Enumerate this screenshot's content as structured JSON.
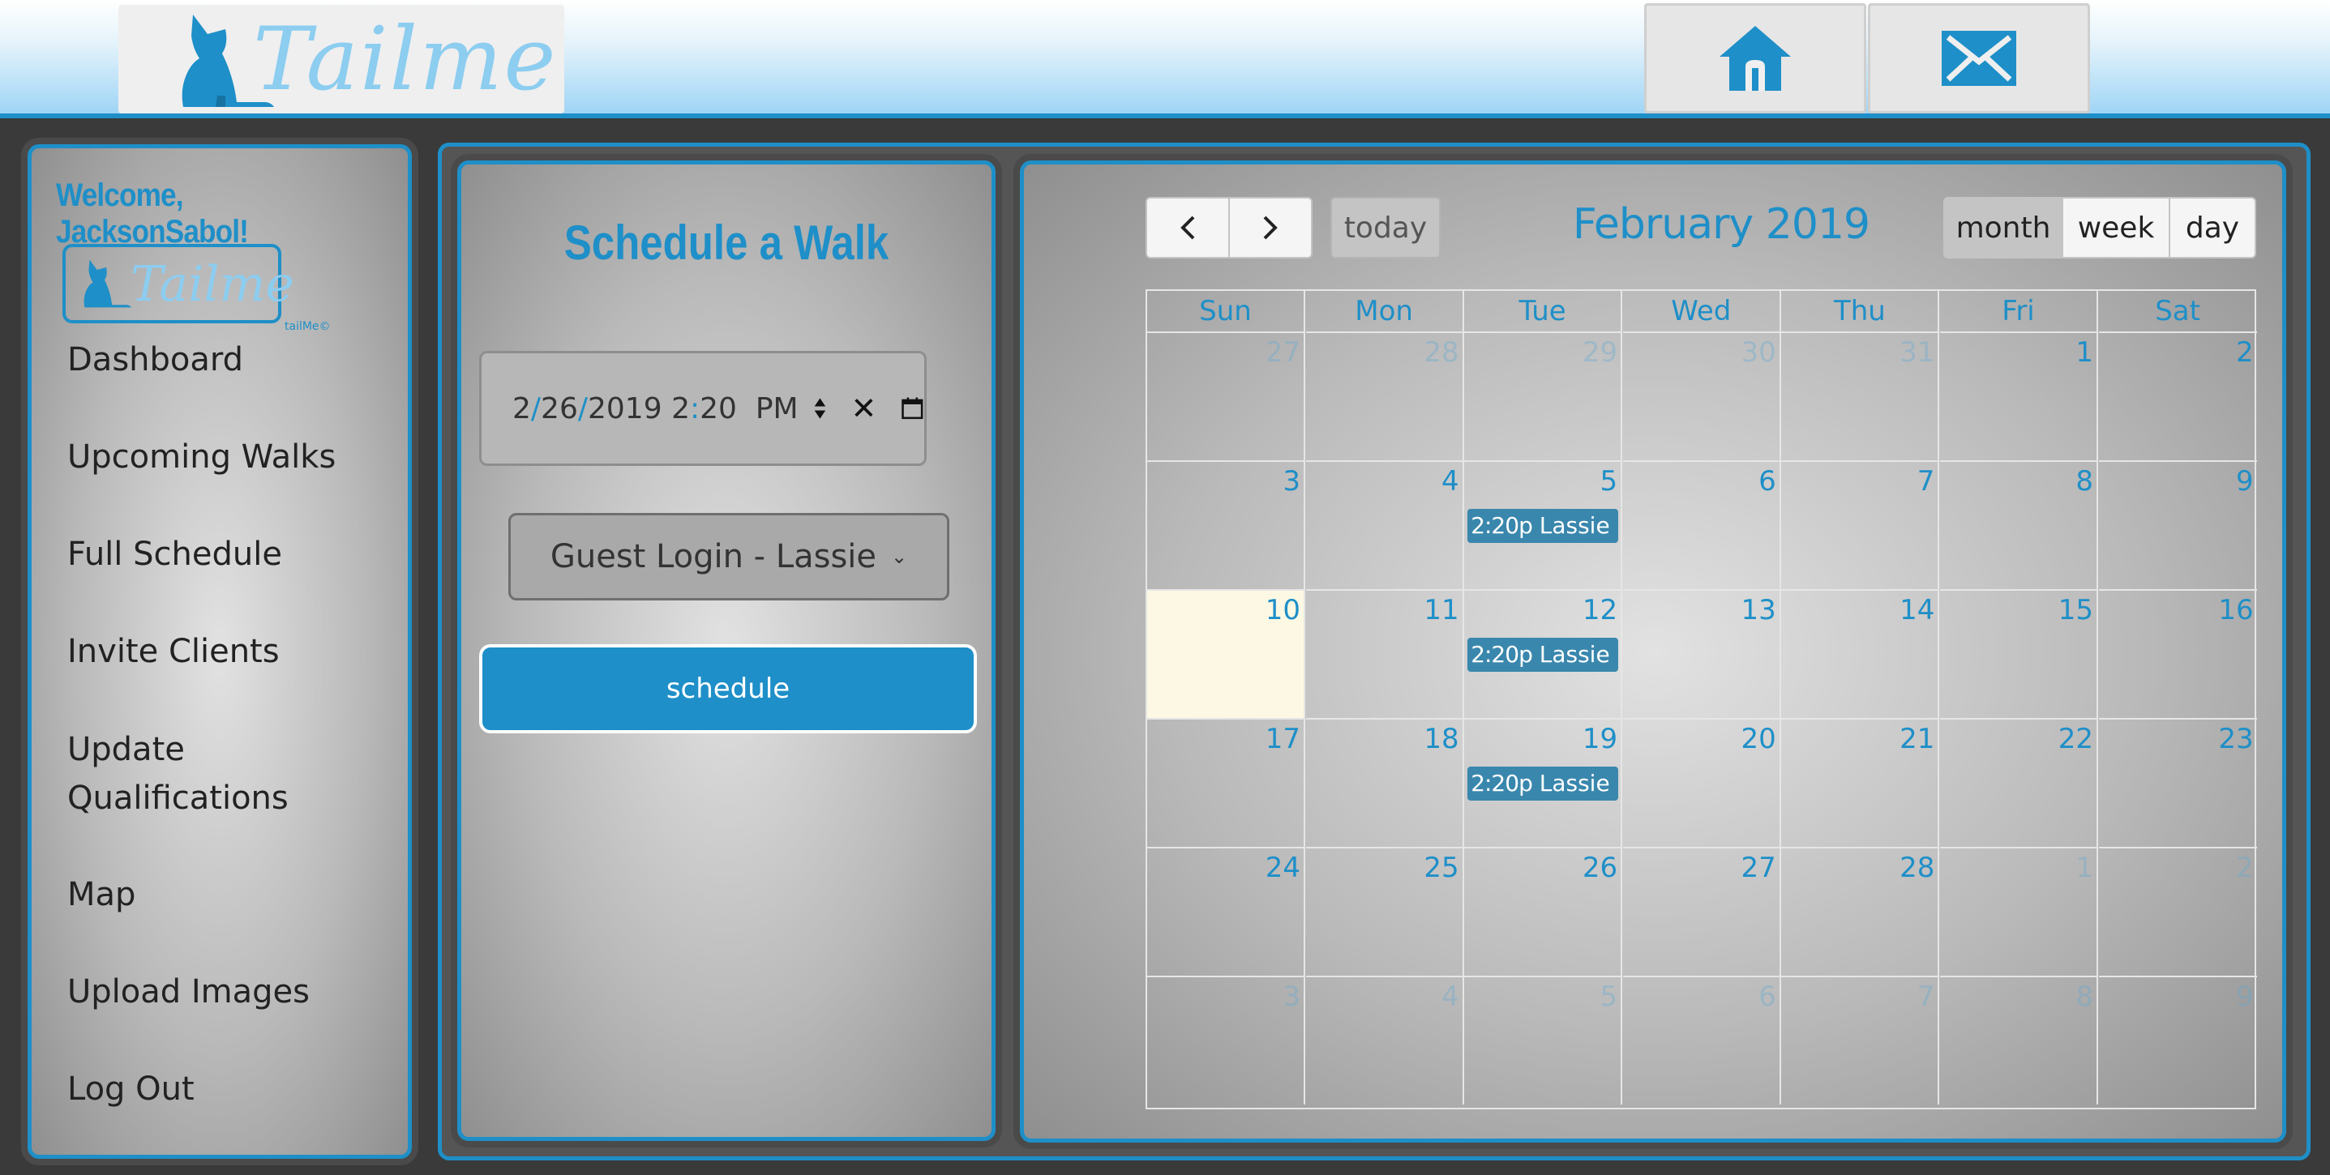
{
  "header": {
    "logo_text": "Tailme",
    "home_button_icon": "home-icon",
    "mail_button_icon": "mail-icon"
  },
  "sidebar": {
    "welcome": "Welcome, JacksonSabol!",
    "mini_logo_text": "Tailme",
    "mini_logo_tm": "tailMe©",
    "items": [
      {
        "label": "Dashboard"
      },
      {
        "label": "Upcoming Walks"
      },
      {
        "label": "Full Schedule"
      },
      {
        "label": "Invite Clients"
      },
      {
        "label": "Update\nQualifications"
      },
      {
        "label": "Map"
      },
      {
        "label": "Upload Images"
      },
      {
        "label": "Log Out"
      }
    ]
  },
  "schedule": {
    "title": "Schedule a Walk",
    "datetime": {
      "month": "2",
      "day": "26",
      "year": "2019",
      "hour": "2",
      "minute": "20",
      "ampm": "PM"
    },
    "client_select": "Guest Login - Lassie",
    "button_label": "schedule"
  },
  "calendar": {
    "title": "February 2019",
    "today_label": "today",
    "views": {
      "month": "month",
      "week": "week",
      "day": "day"
    },
    "active_view": "month",
    "weekdays": [
      "Sun",
      "Mon",
      "Tue",
      "Wed",
      "Thu",
      "Fri",
      "Sat"
    ],
    "weeks": [
      [
        {
          "d": "27",
          "other": true
        },
        {
          "d": "28",
          "other": true
        },
        {
          "d": "29",
          "other": true
        },
        {
          "d": "30",
          "other": true
        },
        {
          "d": "31",
          "other": true
        },
        {
          "d": "1"
        },
        {
          "d": "2"
        }
      ],
      [
        {
          "d": "3"
        },
        {
          "d": "4"
        },
        {
          "d": "5",
          "event": {
            "time": "2:20p",
            "title": "Lassie"
          }
        },
        {
          "d": "6"
        },
        {
          "d": "7"
        },
        {
          "d": "8"
        },
        {
          "d": "9"
        }
      ],
      [
        {
          "d": "10",
          "today": true
        },
        {
          "d": "11"
        },
        {
          "d": "12",
          "event": {
            "time": "2:20p",
            "title": "Lassie"
          }
        },
        {
          "d": "13"
        },
        {
          "d": "14"
        },
        {
          "d": "15"
        },
        {
          "d": "16"
        }
      ],
      [
        {
          "d": "17"
        },
        {
          "d": "18"
        },
        {
          "d": "19",
          "event": {
            "time": "2:20p",
            "title": "Lassie"
          }
        },
        {
          "d": "20"
        },
        {
          "d": "21"
        },
        {
          "d": "22"
        },
        {
          "d": "23"
        }
      ],
      [
        {
          "d": "24"
        },
        {
          "d": "25"
        },
        {
          "d": "26"
        },
        {
          "d": "27"
        },
        {
          "d": "28"
        },
        {
          "d": "1",
          "other": true
        },
        {
          "d": "2",
          "other": true
        }
      ],
      [
        {
          "d": "3",
          "other": true
        },
        {
          "d": "4",
          "other": true
        },
        {
          "d": "5",
          "other": true
        },
        {
          "d": "6",
          "other": true
        },
        {
          "d": "7",
          "other": true
        },
        {
          "d": "8",
          "other": true
        },
        {
          "d": "9",
          "other": true
        }
      ]
    ],
    "event_color": "#3a87ad",
    "today_color": "#fcf8e3"
  },
  "colors": {
    "accent": "#1e8fc8",
    "header_light": "#9fd5f6"
  }
}
